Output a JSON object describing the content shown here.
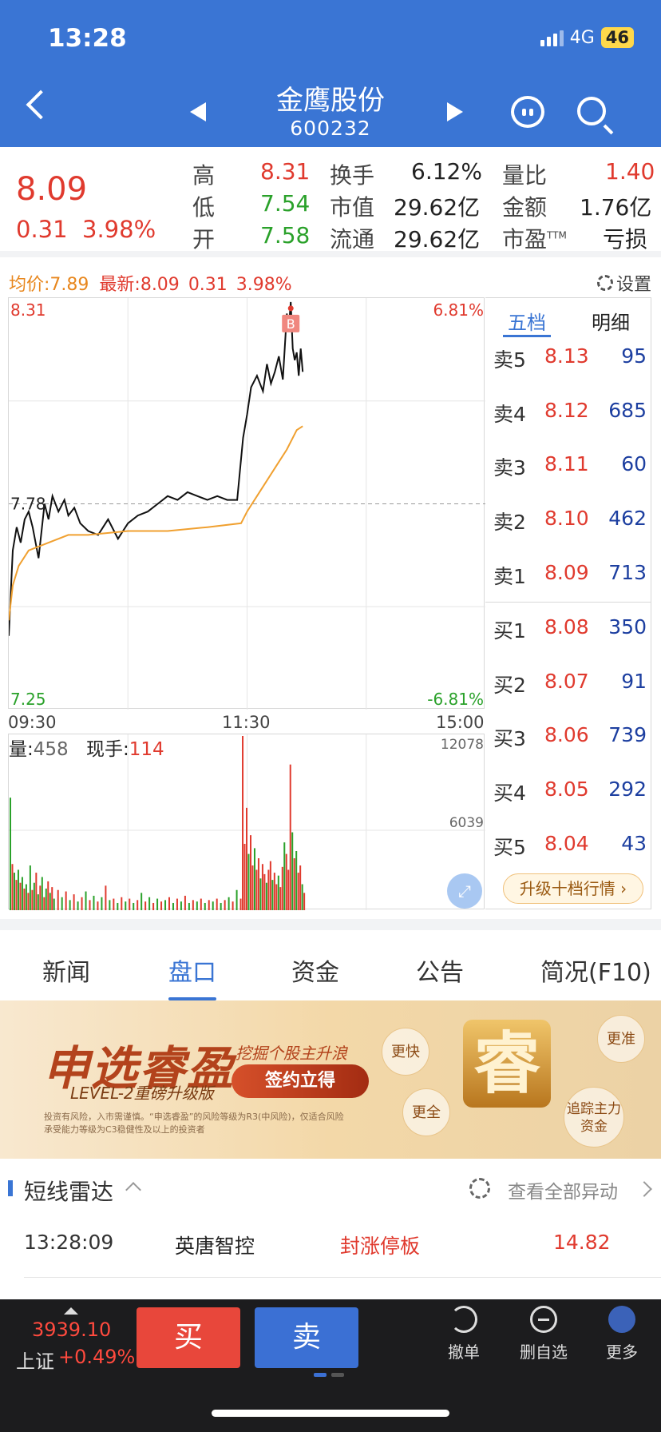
{
  "status_bar": {
    "time": "13:28",
    "network": "4G",
    "battery": "46"
  },
  "header": {
    "stock_name": "金鹰股份",
    "stock_code": "600232"
  },
  "quote": {
    "price": "8.09",
    "change": "0.31",
    "change_pct": "3.98%",
    "fields": [
      {
        "label": "高",
        "value": "8.31"
      },
      {
        "label": "低",
        "value": "7.54"
      },
      {
        "label": "开",
        "value": "7.58"
      },
      {
        "label": "换手",
        "value": "6.12%"
      },
      {
        "label": "市值",
        "value": "29.62亿"
      },
      {
        "label": "流通",
        "value": "29.62亿"
      },
      {
        "label": "量比",
        "value": "1.40"
      },
      {
        "label": "金额",
        "value": "1.76亿"
      },
      {
        "label": "市盈",
        "ttm": "TTM",
        "value": "亏损"
      }
    ]
  },
  "chart_info": {
    "avg_label": "均价:7.89",
    "latest_label": "最新:8.09",
    "latest_change": "0.31",
    "latest_pct": "3.98%",
    "settings_label": "设置"
  },
  "chart_data": {
    "type": "line",
    "y_high_label": "8.31",
    "y_pre_close_label": "7.78",
    "y_low_label": "7.25",
    "pct_high_label": "6.81%",
    "pct_low_label": "-6.81%",
    "x_labels": [
      "09:30",
      "11:30",
      "15:00"
    ],
    "ylim": [
      7.25,
      8.31
    ],
    "pre_close": 7.78,
    "marker_label": "B",
    "series": [
      {
        "name": "价格",
        "x": [
          0,
          2,
          4,
          6,
          8,
          10,
          12,
          15,
          18,
          20,
          22,
          25,
          28,
          30,
          33,
          36,
          40,
          45,
          50,
          55,
          60,
          65,
          70,
          75,
          80,
          85,
          90,
          95,
          100,
          105,
          110,
          115,
          118,
          120,
          122,
          125,
          128,
          130,
          132,
          134,
          136,
          138,
          140,
          141,
          142,
          143,
          144,
          145,
          146,
          147,
          148
        ],
        "values": [
          7.44,
          7.66,
          7.72,
          7.68,
          7.74,
          7.76,
          7.72,
          7.64,
          7.78,
          7.74,
          7.8,
          7.76,
          7.79,
          7.75,
          7.77,
          7.73,
          7.71,
          7.7,
          7.74,
          7.69,
          7.73,
          7.75,
          7.76,
          7.78,
          7.8,
          7.79,
          7.81,
          7.8,
          7.79,
          7.8,
          7.79,
          7.79,
          7.95,
          8.01,
          8.08,
          8.11,
          8.07,
          8.14,
          8.09,
          8.12,
          8.16,
          8.1,
          8.27,
          8.23,
          8.3,
          8.18,
          8.15,
          8.17,
          8.11,
          8.18,
          8.12
        ]
      },
      {
        "name": "均价",
        "x": [
          0,
          2,
          5,
          10,
          20,
          30,
          40,
          60,
          80,
          100,
          117,
          120,
          125,
          130,
          135,
          140,
          145,
          148
        ],
        "values": [
          7.48,
          7.57,
          7.62,
          7.66,
          7.68,
          7.7,
          7.7,
          7.71,
          7.71,
          7.72,
          7.73,
          7.76,
          7.8,
          7.84,
          7.88,
          7.92,
          7.97,
          7.98
        ]
      }
    ],
    "volume": {
      "label": "量",
      "value": "458",
      "current_label": "现手",
      "current_value": "114",
      "axis_max_label": "12078",
      "axis_mid_label": "6039",
      "ymax": 12078,
      "bars": [
        {
          "x": 0,
          "v": 7800,
          "c": "g"
        },
        {
          "x": 1,
          "v": 3200,
          "c": "r"
        },
        {
          "x": 2,
          "v": 2600,
          "c": "g"
        },
        {
          "x": 3,
          "v": 2100,
          "c": "r"
        },
        {
          "x": 4,
          "v": 2800,
          "c": "g"
        },
        {
          "x": 5,
          "v": 1900,
          "c": "r"
        },
        {
          "x": 6,
          "v": 2300,
          "c": "g"
        },
        {
          "x": 7,
          "v": 1500,
          "c": "r"
        },
        {
          "x": 8,
          "v": 1800,
          "c": "g"
        },
        {
          "x": 9,
          "v": 1200,
          "c": "r"
        },
        {
          "x": 10,
          "v": 3100,
          "c": "g"
        },
        {
          "x": 11,
          "v": 1400,
          "c": "r"
        },
        {
          "x": 12,
          "v": 1900,
          "c": "g"
        },
        {
          "x": 13,
          "v": 2600,
          "c": "r"
        },
        {
          "x": 14,
          "v": 1100,
          "c": "g"
        },
        {
          "x": 15,
          "v": 1700,
          "c": "r"
        },
        {
          "x": 16,
          "v": 2300,
          "c": "g"
        },
        {
          "x": 17,
          "v": 900,
          "c": "r"
        },
        {
          "x": 18,
          "v": 1500,
          "c": "g"
        },
        {
          "x": 19,
          "v": 2000,
          "c": "r"
        },
        {
          "x": 20,
          "v": 1200,
          "c": "g"
        },
        {
          "x": 21,
          "v": 1600,
          "c": "r"
        },
        {
          "x": 22,
          "v": 800,
          "c": "g"
        },
        {
          "x": 24,
          "v": 1400,
          "c": "r"
        },
        {
          "x": 26,
          "v": 900,
          "c": "g"
        },
        {
          "x": 28,
          "v": 1300,
          "c": "r"
        },
        {
          "x": 30,
          "v": 700,
          "c": "g"
        },
        {
          "x": 32,
          "v": 1100,
          "c": "r"
        },
        {
          "x": 34,
          "v": 600,
          "c": "g"
        },
        {
          "x": 36,
          "v": 900,
          "c": "r"
        },
        {
          "x": 38,
          "v": 1300,
          "c": "g"
        },
        {
          "x": 40,
          "v": 700,
          "c": "r"
        },
        {
          "x": 42,
          "v": 1000,
          "c": "g"
        },
        {
          "x": 44,
          "v": 600,
          "c": "r"
        },
        {
          "x": 46,
          "v": 900,
          "c": "g"
        },
        {
          "x": 48,
          "v": 1700,
          "c": "r"
        },
        {
          "x": 50,
          "v": 700,
          "c": "g"
        },
        {
          "x": 52,
          "v": 800,
          "c": "r"
        },
        {
          "x": 54,
          "v": 500,
          "c": "g"
        },
        {
          "x": 56,
          "v": 900,
          "c": "r"
        },
        {
          "x": 58,
          "v": 600,
          "c": "g"
        },
        {
          "x": 60,
          "v": 800,
          "c": "r"
        },
        {
          "x": 62,
          "v": 500,
          "c": "g"
        },
        {
          "x": 64,
          "v": 700,
          "c": "r"
        },
        {
          "x": 66,
          "v": 1200,
          "c": "g"
        },
        {
          "x": 68,
          "v": 600,
          "c": "r"
        },
        {
          "x": 70,
          "v": 900,
          "c": "g"
        },
        {
          "x": 72,
          "v": 500,
          "c": "r"
        },
        {
          "x": 74,
          "v": 800,
          "c": "g"
        },
        {
          "x": 76,
          "v": 600,
          "c": "r"
        },
        {
          "x": 78,
          "v": 700,
          "c": "g"
        },
        {
          "x": 80,
          "v": 900,
          "c": "r"
        },
        {
          "x": 82,
          "v": 500,
          "c": "g"
        },
        {
          "x": 84,
          "v": 800,
          "c": "r"
        },
        {
          "x": 86,
          "v": 600,
          "c": "g"
        },
        {
          "x": 88,
          "v": 1000,
          "c": "r"
        },
        {
          "x": 90,
          "v": 500,
          "c": "g"
        },
        {
          "x": 92,
          "v": 700,
          "c": "r"
        },
        {
          "x": 94,
          "v": 600,
          "c": "g"
        },
        {
          "x": 96,
          "v": 800,
          "c": "r"
        },
        {
          "x": 98,
          "v": 500,
          "c": "g"
        },
        {
          "x": 100,
          "v": 700,
          "c": "r"
        },
        {
          "x": 102,
          "v": 600,
          "c": "g"
        },
        {
          "x": 104,
          "v": 800,
          "c": "r"
        },
        {
          "x": 106,
          "v": 500,
          "c": "g"
        },
        {
          "x": 108,
          "v": 700,
          "c": "r"
        },
        {
          "x": 110,
          "v": 900,
          "c": "g"
        },
        {
          "x": 112,
          "v": 600,
          "c": "r"
        },
        {
          "x": 114,
          "v": 1400,
          "c": "g"
        },
        {
          "x": 116,
          "v": 800,
          "c": "r"
        },
        {
          "x": 117,
          "v": 12078,
          "c": "r"
        },
        {
          "x": 118,
          "v": 4600,
          "c": "r"
        },
        {
          "x": 119,
          "v": 7100,
          "c": "r"
        },
        {
          "x": 120,
          "v": 3900,
          "c": "g"
        },
        {
          "x": 121,
          "v": 5200,
          "c": "r"
        },
        {
          "x": 122,
          "v": 3100,
          "c": "r"
        },
        {
          "x": 123,
          "v": 4300,
          "c": "g"
        },
        {
          "x": 124,
          "v": 2800,
          "c": "r"
        },
        {
          "x": 125,
          "v": 3600,
          "c": "r"
        },
        {
          "x": 126,
          "v": 2200,
          "c": "g"
        },
        {
          "x": 127,
          "v": 3200,
          "c": "r"
        },
        {
          "x": 128,
          "v": 2500,
          "c": "r"
        },
        {
          "x": 129,
          "v": 1900,
          "c": "g"
        },
        {
          "x": 130,
          "v": 2800,
          "c": "r"
        },
        {
          "x": 131,
          "v": 3400,
          "c": "r"
        },
        {
          "x": 132,
          "v": 2100,
          "c": "g"
        },
        {
          "x": 133,
          "v": 2600,
          "c": "r"
        },
        {
          "x": 134,
          "v": 1800,
          "c": "r"
        },
        {
          "x": 135,
          "v": 2400,
          "c": "g"
        },
        {
          "x": 136,
          "v": 1600,
          "c": "r"
        },
        {
          "x": 137,
          "v": 3000,
          "c": "r"
        },
        {
          "x": 138,
          "v": 4700,
          "c": "g"
        },
        {
          "x": 139,
          "v": 3900,
          "c": "r"
        },
        {
          "x": 140,
          "v": 2800,
          "c": "r"
        },
        {
          "x": 141,
          "v": 10100,
          "c": "r"
        },
        {
          "x": 142,
          "v": 5400,
          "c": "g"
        },
        {
          "x": 143,
          "v": 3600,
          "c": "r"
        },
        {
          "x": 144,
          "v": 4100,
          "c": "g"
        },
        {
          "x": 145,
          "v": 2600,
          "c": "r"
        },
        {
          "x": 146,
          "v": 3100,
          "c": "r"
        },
        {
          "x": 147,
          "v": 1800,
          "c": "g"
        },
        {
          "x": 148,
          "v": 1200,
          "c": "r"
        }
      ]
    },
    "colors": {
      "price": "#111111",
      "avg": "#f0a030",
      "up": "#e03a2e",
      "down": "#2aa12a"
    }
  },
  "order_book": {
    "tabs": [
      "五档",
      "明细"
    ],
    "sells": [
      {
        "label": "卖5",
        "price": "8.13",
        "vol": "95"
      },
      {
        "label": "卖4",
        "price": "8.12",
        "vol": "685"
      },
      {
        "label": "卖3",
        "price": "8.11",
        "vol": "60"
      },
      {
        "label": "卖2",
        "price": "8.10",
        "vol": "462"
      },
      {
        "label": "卖1",
        "price": "8.09",
        "vol": "713"
      }
    ],
    "buys": [
      {
        "label": "买1",
        "price": "8.08",
        "vol": "350"
      },
      {
        "label": "买2",
        "price": "8.07",
        "vol": "91"
      },
      {
        "label": "买3",
        "price": "8.06",
        "vol": "739"
      },
      {
        "label": "买4",
        "price": "8.05",
        "vol": "292"
      },
      {
        "label": "买5",
        "price": "8.04",
        "vol": "43"
      }
    ],
    "upgrade_label": "升级十档行情 ›"
  },
  "tabs": [
    "新闻",
    "盘口",
    "资金",
    "公告",
    "简况(F10)"
  ],
  "banner": {
    "title": "申选睿盈",
    "subtitle": "LEVEL-2重磅升级版",
    "slogan": "挖掘个股主升浪",
    "cta": "签约立得",
    "disclaimer": "投资有风险，入市需谨慎。“申选睿盈”的风险等级为R3(中风险)，仅适合风险承受能力等级为C3稳健性及以上的投资者",
    "emblem": "睿",
    "bubbles": [
      "更快",
      "更准",
      "更全",
      "追踪主力资金"
    ]
  },
  "radar": {
    "title": "短线雷达",
    "view_all": "查看全部异动",
    "items": [
      {
        "time": "13:28:09",
        "name": "英唐智控",
        "event": "封涨停板",
        "value": "14.82"
      }
    ]
  },
  "bottom_bar": {
    "index_value": "3939.10",
    "index_name": "上证",
    "index_change": "+0.49%",
    "buy": "买",
    "sell": "卖",
    "actions": [
      "撤单",
      "删自选",
      "更多"
    ]
  }
}
